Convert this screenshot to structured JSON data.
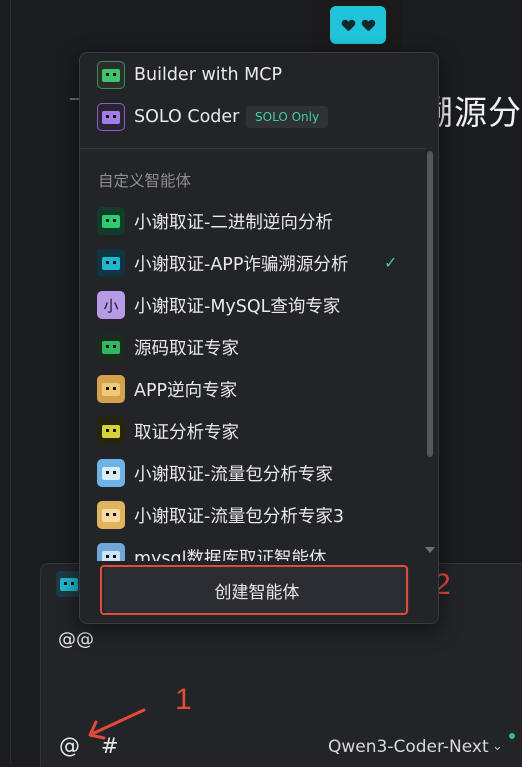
{
  "background": {
    "partial_title": "溯源分"
  },
  "dropdown": {
    "top_items": [
      {
        "label": "Builder with MCP",
        "icon": "builder-agent-icon"
      },
      {
        "label": "SOLO Coder",
        "icon": "solo-agent-icon",
        "tag": "SOLO Only"
      }
    ],
    "section_label": "自定义智能体",
    "custom_agents": [
      {
        "label": "小谢取证-二进制逆向分析",
        "icon": "robot-green-icon",
        "selected": false
      },
      {
        "label": "小谢取证-APP诈骗溯源分析",
        "icon": "robot-cyan-icon",
        "selected": true
      },
      {
        "label": "小谢取证-MySQL查询专家",
        "icon": "letter-avatar-icon",
        "avatar_text": "小",
        "selected": false
      },
      {
        "label": "源码取证专家",
        "icon": "robot-green-icon",
        "selected": false
      },
      {
        "label": "APP逆向专家",
        "icon": "robot-orange-icon",
        "selected": false
      },
      {
        "label": "取证分析专家",
        "icon": "robot-yellow-icon",
        "selected": false
      },
      {
        "label": "小谢取证-流量包分析专家",
        "icon": "robot-blue-icon",
        "selected": false
      },
      {
        "label": "小谢取证-流量包分析专家3",
        "icon": "robot-orange-icon",
        "selected": false
      },
      {
        "label": "mysql数据库取证智能体",
        "icon": "robot-blue-icon",
        "selected": false
      }
    ],
    "check_mark": "✓",
    "create_button_label": "创建智能体"
  },
  "chat": {
    "input_text": "@@",
    "at_label": "@",
    "hash_label": "#",
    "model_name": "Qwen3-Coder-Next",
    "chevron": "⌄"
  },
  "annotations": {
    "label_1": "1",
    "label_2": "2",
    "color": "#e04b3a"
  },
  "colors": {
    "accent_green": "#3fcf9e",
    "panel": "#232428",
    "background": "#1b1c20"
  }
}
